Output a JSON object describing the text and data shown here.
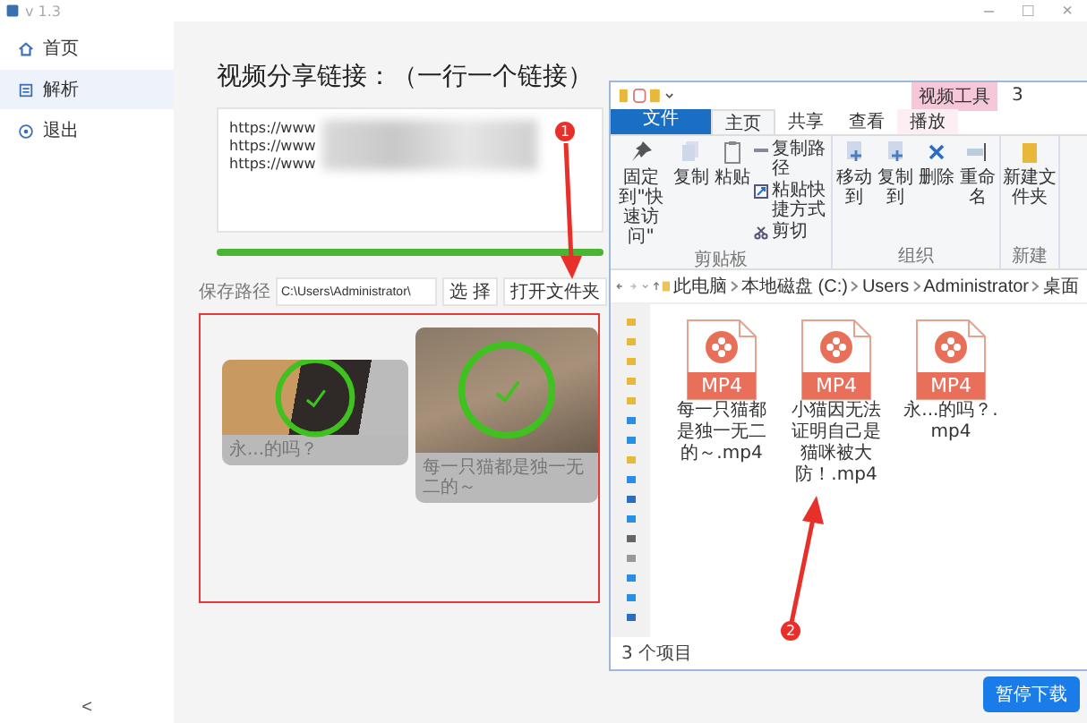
{
  "window": {
    "title": "v 1.3",
    "controls": [
      "–",
      "□",
      "×"
    ]
  },
  "sidebar": {
    "items": [
      {
        "label": "首页",
        "selected": false
      },
      {
        "label": "解析",
        "selected": true
      },
      {
        "label": "退出",
        "selected": false
      }
    ],
    "collapse": "<"
  },
  "main": {
    "heading": "视频分享链接：（一行一个链接）",
    "links": [
      "https://www",
      "https://www",
      "https://www"
    ],
    "progress": {
      "level": 1
    },
    "save_path": {
      "label": "保存路径",
      "value": "C:\\Users\\Administrator\\"
    },
    "buttons": [
      "选 择",
      "打开文件夹"
    ],
    "videos": [
      {
        "caption": "永...的吗？",
        "checked": true
      },
      {
        "caption": "每一只猫都是独一无二的～",
        "checked": true
      }
    ],
    "pause_button": "暂停下载"
  },
  "annotations": [
    {
      "label": "1"
    },
    {
      "label": "2"
    }
  ],
  "explorer": {
    "context_tab": "视频工具",
    "title": "3",
    "tabs": [
      {
        "label": "文件",
        "kind": "file",
        "selected": false
      },
      {
        "label": "主页",
        "kind": "tab",
        "selected": true
      },
      {
        "label": "共享",
        "kind": "tab",
        "selected": false
      },
      {
        "label": "查看",
        "kind": "tab",
        "selected": false
      },
      {
        "label": "播放",
        "kind": "context",
        "selected": false
      }
    ],
    "ribbon": [
      {
        "group": "剪贴板",
        "large": [
          "固定到\"快速访问\"",
          "复制",
          "粘贴"
        ],
        "small": [
          "复制路径",
          "粘贴快捷方式",
          "剪切"
        ]
      },
      {
        "group": "组织",
        "large": [
          "移动到",
          "复制到",
          "删除",
          "重命名"
        ]
      },
      {
        "group": "新建",
        "large": [
          "新建文件夹"
        ]
      }
    ],
    "address": [
      "此电脑",
      "本地磁盘 (C:)",
      "Users",
      "Administrator",
      "桌面"
    ],
    "files": [
      {
        "type": "MP4",
        "name": "每一只猫都是独一无二的～.mp4"
      },
      {
        "type": "MP4",
        "name": "小猫因无法证明自己是猫咪被大防！.mp4"
      },
      {
        "type": "MP4",
        "name": "永...的吗？.mp4"
      }
    ],
    "status": "3 个项目"
  }
}
